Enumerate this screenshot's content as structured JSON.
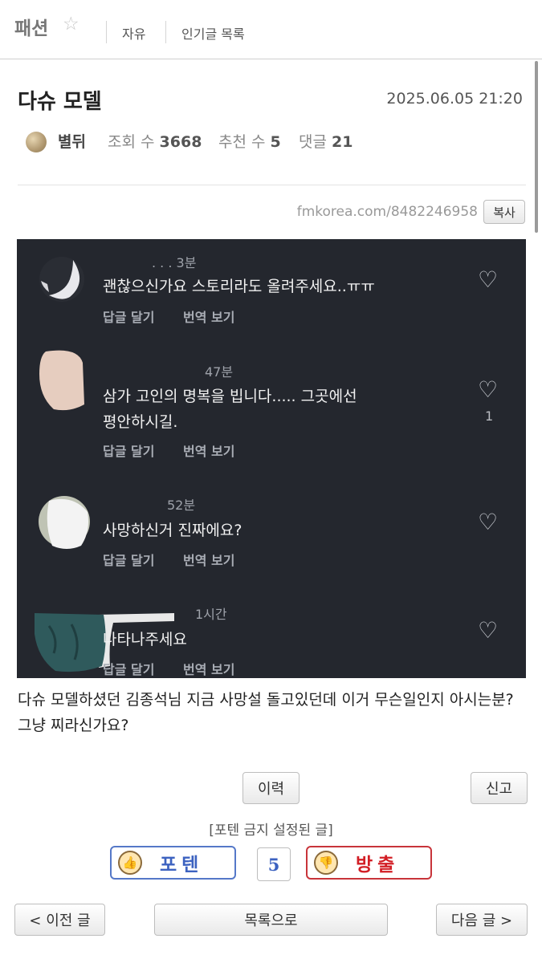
{
  "nav": {
    "board_name": "패션",
    "star_icon": "★",
    "tab_free": "자유",
    "tab_popular": "인기글 목록"
  },
  "post": {
    "title": "다슈 모델",
    "date": "2025.06.05 21:20",
    "author": "별뒤",
    "views_label": "조회 수",
    "views": "3668",
    "votes_label": "추천 수",
    "votes": "5",
    "comments_label": "댓글",
    "comments": "21",
    "url": "fmkorea.com/8482246958",
    "copy_label": "복사",
    "body": "다슈 모델하셨던 김종석님 지금 사망설 돌고있던데 이거 무슨일인지 아시는분? 그냥 찌라신가요?"
  },
  "screenshot_comments": [
    {
      "time": ". . .  3분",
      "text": "괜찮으신가요 스토리라도 올려주세요..ㅠㅠ",
      "reply": "답글 달기",
      "translate": "번역 보기",
      "likes": ""
    },
    {
      "time": "47분",
      "text": "삼가 고인의 명복을 빕니다..... 그곳에선\n평안하시길.",
      "reply": "답글 달기",
      "translate": "번역 보기",
      "likes": "1"
    },
    {
      "time": "52분",
      "text": "사망하신거 진짜에요?",
      "reply": "답글 달기",
      "translate": "번역 보기",
      "likes": ""
    },
    {
      "time": "1시간",
      "text": "나타나주세요",
      "reply": "답글 달기",
      "translate": "번역 보기",
      "likes": ""
    }
  ],
  "actions": {
    "history": "이력",
    "report": "신고",
    "protect_label": "[포텐 금지 설정된 글]",
    "upvote": "포텐",
    "vote_count": "5",
    "downvote": "방출",
    "prev": "< 이전 글",
    "list": "목록으로",
    "next": "다음 글 >"
  },
  "colors": {
    "upvote": "#3c62c0",
    "downvote": "#d21e25",
    "screenshot_bg": "#24272e"
  }
}
